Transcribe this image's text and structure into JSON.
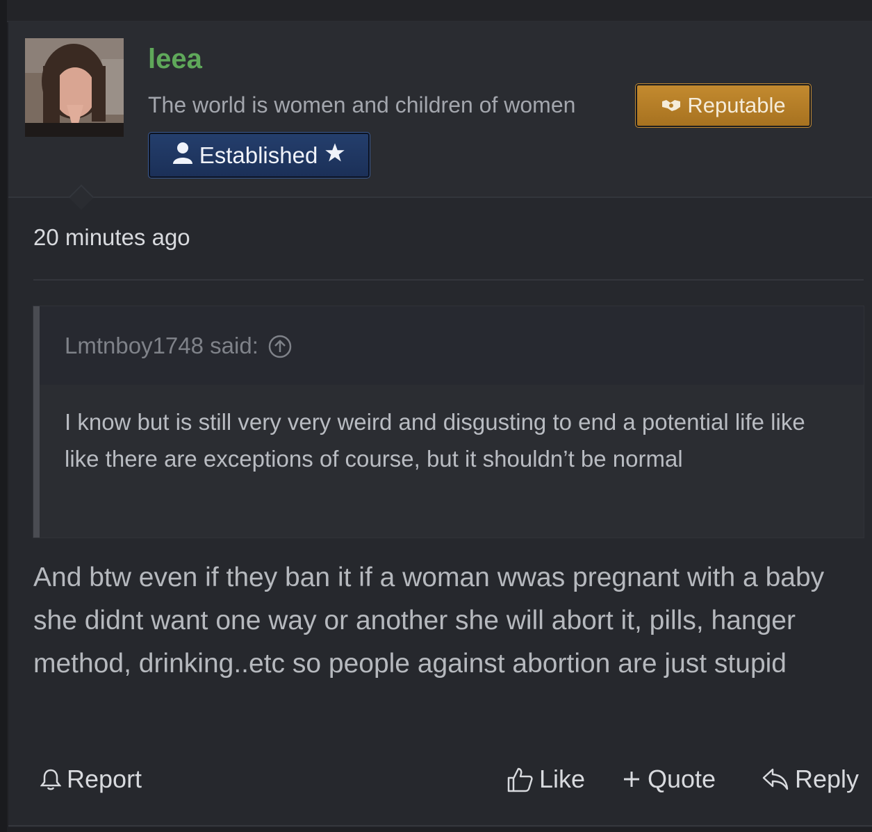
{
  "post": {
    "username": "leea",
    "user_title": "The world is women and children of women",
    "badges": {
      "reputable": "Reputable",
      "established": "Established"
    },
    "timestamp": "20 minutes ago",
    "quote": {
      "author_line": "Lmtnboy1748 said:",
      "text": "I know but is still very very weird and disgusting to end a potential life like like there are exceptions of course, but it shouldn’t be normal"
    },
    "message": "And btw even if they ban it if a woman wwas pregnant with a baby she didnt want one way or another she will abort it, pills, hanger method, drinking..etc so people against abortion are just stupid",
    "actions": {
      "report": "Report",
      "like": "Like",
      "quote": "Quote",
      "reply": "Reply"
    }
  },
  "colors": {
    "username": "#5fa85a",
    "reputable_badge": "#b57e27",
    "established_badge": "#213a66"
  }
}
